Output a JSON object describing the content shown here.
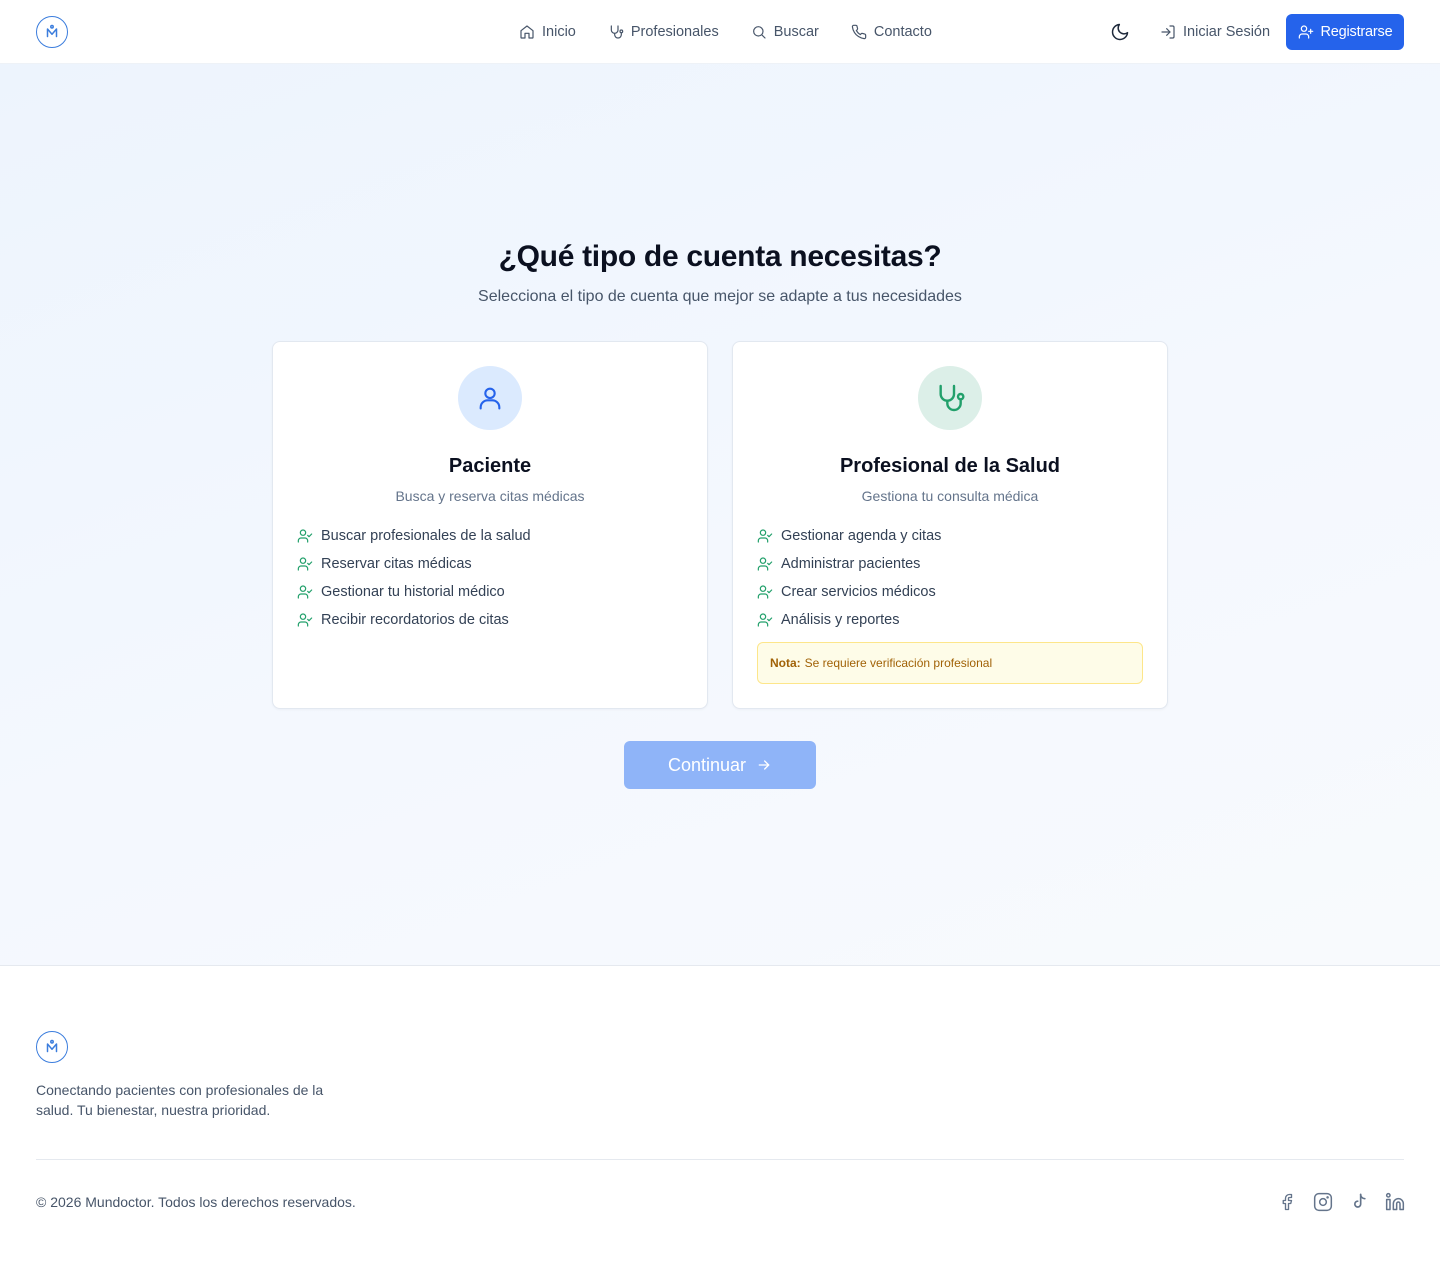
{
  "header": {
    "logo_icon": "mundoctor-logo-icon",
    "nav": [
      {
        "label": "Inicio",
        "icon": "home-icon"
      },
      {
        "label": "Profesionales",
        "icon": "stethoscope-icon"
      },
      {
        "label": "Buscar",
        "icon": "search-icon"
      },
      {
        "label": "Contacto",
        "icon": "phone-icon"
      }
    ],
    "theme_icon": "moon-icon",
    "login_label": "Iniciar Sesión",
    "register_label": "Registrarse"
  },
  "main": {
    "title": "¿Qué tipo de cuenta necesitas?",
    "subtitle": "Selecciona el tipo de cuenta que mejor se adapte a tus necesidades",
    "cards": [
      {
        "title": "Paciente",
        "subtitle": "Busca y reserva citas médicas",
        "icon": "user-icon",
        "features": [
          "Buscar profesionales de la salud",
          "Reservar citas médicas",
          "Gestionar tu historial médico",
          "Recibir recordatorios de citas"
        ]
      },
      {
        "title": "Profesional de la Salud",
        "subtitle": "Gestiona tu consulta médica",
        "icon": "stethoscope-icon",
        "features": [
          "Gestionar agenda y citas",
          "Administrar pacientes",
          "Crear servicios médicos",
          "Análisis y reportes"
        ],
        "note_label": "Nota:",
        "note_text": "Se requiere verificación profesional"
      }
    ],
    "continue_label": "Continuar"
  },
  "footer": {
    "tagline": "Conectando pacientes con profesionales de la salud. Tu bienestar, nuestra prioridad.",
    "copyright": "© 2026 Mundoctor. Todos los derechos reservados.",
    "social": [
      "facebook-icon",
      "instagram-icon",
      "tiktok-icon",
      "linkedin-icon"
    ]
  },
  "colors": {
    "primary": "#2563eb",
    "primary_disabled": "#8fb4f8",
    "success": "#22a06b",
    "note_bg": "#fefce8",
    "note_text": "#a16207"
  }
}
